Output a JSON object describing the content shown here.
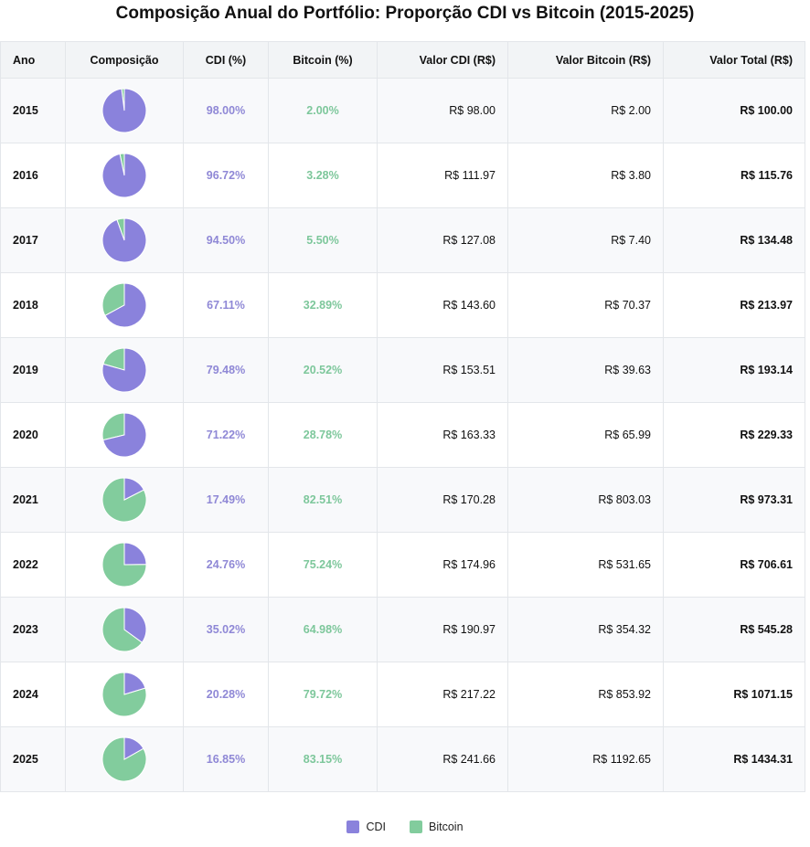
{
  "title": "Composição Anual do Portfólio: Proporção CDI vs Bitcoin (2015-2025)",
  "colors": {
    "cdi": "#8a82dc",
    "bitcoin": "#82cc9d",
    "cdi_text": "#8f88d6",
    "bitcoin_text": "#7dc79b"
  },
  "headers": {
    "year": "Ano",
    "composition": "Composição",
    "cdi_pct": "CDI (%)",
    "btc_pct": "Bitcoin (%)",
    "cdi_value": "Valor CDI (R$)",
    "btc_value": "Valor Bitcoin (R$)",
    "total_value": "Valor Total (R$)"
  },
  "rows": [
    {
      "year": "2015",
      "cdi_pct": "98.00%",
      "btc_pct": "2.00%",
      "cdi_value": "R$ 98.00",
      "btc_value": "R$ 2.00",
      "total_value": "R$ 100.00"
    },
    {
      "year": "2016",
      "cdi_pct": "96.72%",
      "btc_pct": "3.28%",
      "cdi_value": "R$ 111.97",
      "btc_value": "R$ 3.80",
      "total_value": "R$ 115.76"
    },
    {
      "year": "2017",
      "cdi_pct": "94.50%",
      "btc_pct": "5.50%",
      "cdi_value": "R$ 127.08",
      "btc_value": "R$ 7.40",
      "total_value": "R$ 134.48"
    },
    {
      "year": "2018",
      "cdi_pct": "67.11%",
      "btc_pct": "32.89%",
      "cdi_value": "R$ 143.60",
      "btc_value": "R$ 70.37",
      "total_value": "R$ 213.97"
    },
    {
      "year": "2019",
      "cdi_pct": "79.48%",
      "btc_pct": "20.52%",
      "cdi_value": "R$ 153.51",
      "btc_value": "R$ 39.63",
      "total_value": "R$ 193.14"
    },
    {
      "year": "2020",
      "cdi_pct": "71.22%",
      "btc_pct": "28.78%",
      "cdi_value": "R$ 163.33",
      "btc_value": "R$ 65.99",
      "total_value": "R$ 229.33"
    },
    {
      "year": "2021",
      "cdi_pct": "17.49%",
      "btc_pct": "82.51%",
      "cdi_value": "R$ 170.28",
      "btc_value": "R$ 803.03",
      "total_value": "R$ 973.31"
    },
    {
      "year": "2022",
      "cdi_pct": "24.76%",
      "btc_pct": "75.24%",
      "cdi_value": "R$ 174.96",
      "btc_value": "R$ 531.65",
      "total_value": "R$ 706.61"
    },
    {
      "year": "2023",
      "cdi_pct": "35.02%",
      "btc_pct": "64.98%",
      "cdi_value": "R$ 190.97",
      "btc_value": "R$ 354.32",
      "total_value": "R$ 545.28"
    },
    {
      "year": "2024",
      "cdi_pct": "20.28%",
      "btc_pct": "79.72%",
      "cdi_value": "R$ 217.22",
      "btc_value": "R$ 853.92",
      "total_value": "R$ 1071.15"
    },
    {
      "year": "2025",
      "cdi_pct": "16.85%",
      "btc_pct": "83.15%",
      "cdi_value": "R$ 241.66",
      "btc_value": "R$ 1192.65",
      "total_value": "R$ 1434.31"
    }
  ],
  "legend": {
    "cdi": "CDI",
    "bitcoin": "Bitcoin"
  },
  "chart_data": {
    "type": "pie",
    "title": "Composição Anual do Portfólio: Proporção CDI vs Bitcoin (2015-2025)",
    "categories": [
      "2015",
      "2016",
      "2017",
      "2018",
      "2019",
      "2020",
      "2021",
      "2022",
      "2023",
      "2024",
      "2025"
    ],
    "series": [
      {
        "name": "CDI",
        "values": [
          98.0,
          96.72,
          94.5,
          67.11,
          79.48,
          71.22,
          17.49,
          24.76,
          35.02,
          20.28,
          16.85
        ]
      },
      {
        "name": "Bitcoin",
        "values": [
          2.0,
          3.28,
          5.5,
          32.89,
          20.52,
          28.78,
          82.51,
          75.24,
          64.98,
          79.72,
          83.15
        ]
      }
    ],
    "legend_position": "bottom-center"
  }
}
